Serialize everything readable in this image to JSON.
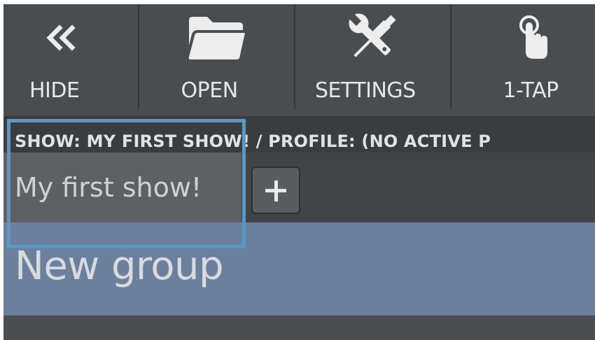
{
  "toolbar": {
    "items": [
      {
        "label": "HIDE",
        "icon": "double-chevron-left-icon"
      },
      {
        "label": "OPEN",
        "icon": "folder-icon"
      },
      {
        "label": "SETTINGS",
        "icon": "tools-icon"
      },
      {
        "label": "1-TAP",
        "icon": "tap-hand-icon"
      }
    ]
  },
  "breadcrumb": {
    "text": "SHOW: MY FIRST SHOW! / PROFILE: (NO ACTIVE P"
  },
  "shows": {
    "tabs": [
      {
        "label": "My first show!",
        "selected": true
      }
    ],
    "add_button": "+"
  },
  "groups": [
    {
      "label": "New group"
    }
  ],
  "colors": {
    "toolbar_bg": "#4a4d50",
    "group_bg": "#6a809d",
    "focus": "#5b98c2",
    "text": "#e6e6e6"
  }
}
